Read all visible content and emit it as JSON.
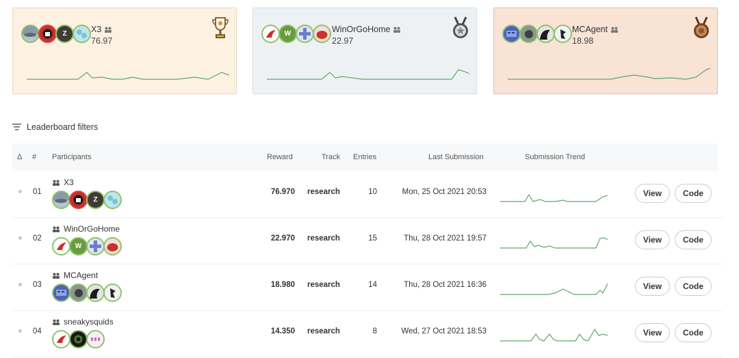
{
  "podium": [
    {
      "rank_tier": "gold",
      "name": "X3",
      "score": "76.97",
      "icon": "gold-trophy-icon"
    },
    {
      "rank_tier": "silver",
      "name": "WinOrGoHome",
      "score": "22.97",
      "icon": "silver-medal-icon"
    },
    {
      "rank_tier": "bronze",
      "name": "MCAgent",
      "score": "18.98",
      "icon": "bronze-medal-icon"
    }
  ],
  "filters": {
    "label": "Leaderboard filters"
  },
  "table": {
    "headers": {
      "delta": "Δ",
      "rank": "#",
      "participants": "Participants",
      "reward": "Reward",
      "track": "Track",
      "entries": "Entries",
      "last_submission": "Last Submission",
      "trend": "Submission Trend"
    },
    "rows": [
      {
        "rank": "01",
        "name": "X3",
        "reward": "76.970",
        "track": "research",
        "entries": "10",
        "last": "Mon, 25 Oct 2021 20:53",
        "view": "View",
        "code": "Code"
      },
      {
        "rank": "02",
        "name": "WinOrGoHome",
        "reward": "22.970",
        "track": "research",
        "entries": "15",
        "last": "Thu, 28 Oct 2021 19:57",
        "view": "View",
        "code": "Code"
      },
      {
        "rank": "03",
        "name": "MCAgent",
        "reward": "18.980",
        "track": "research",
        "entries": "14",
        "last": "Thu, 28 Oct 2021 16:36",
        "view": "View",
        "code": "Code"
      },
      {
        "rank": "04",
        "name": "sneakysquids",
        "reward": "14.350",
        "track": "research",
        "entries": "8",
        "last": "Wed, 27 Oct 2021 18:53",
        "view": "View",
        "code": "Code"
      }
    ]
  },
  "colors": {
    "trend_line": "#5aa86a",
    "avatar_ring": "#8cc46a",
    "avatar_ring_red": "#d9453d"
  }
}
